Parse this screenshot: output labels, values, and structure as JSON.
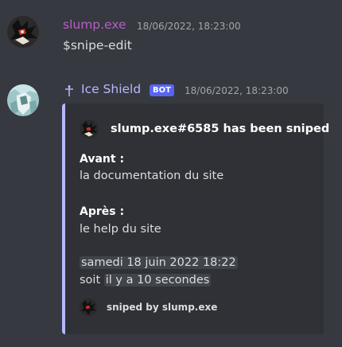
{
  "messages": [
    {
      "username": "slump.exe",
      "username_color": "#b65fc7",
      "timestamp": "18/06/2022, 18:23:00",
      "content": "$snipe-edit"
    },
    {
      "username": "Ice Shield",
      "username_color": "#b6b8ff",
      "badge": "BOT",
      "timestamp": "18/06/2022, 18:23:00",
      "embed": {
        "author": "slump.exe#6585 has been sniped",
        "fields": [
          {
            "name": "Avant :",
            "value": "la documentation du site"
          },
          {
            "name": "Après :",
            "value": "le help du site"
          }
        ],
        "date_line": "samedi 18 juin 2022 18:22",
        "relative_prefix": "soit",
        "relative_time": "il y a 10 secondes",
        "footer": "sniped by slump.exe",
        "border_color": "#b6b8ff"
      }
    }
  ]
}
